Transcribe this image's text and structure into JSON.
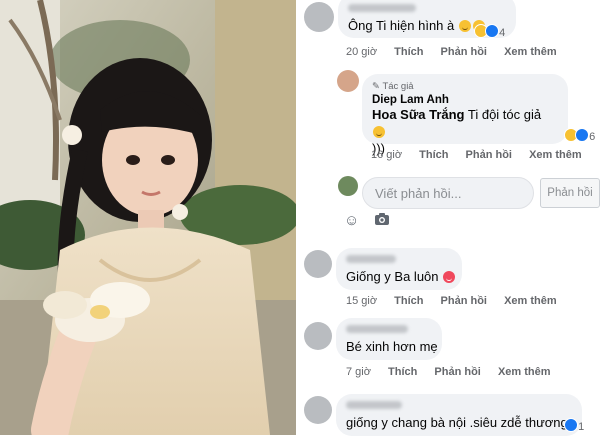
{
  "comments": [
    {
      "text": "Ông Ti hiện hình à",
      "reaction_count": "4",
      "meta": {
        "time": "20 giờ",
        "like": "Thích",
        "reply": "Phản hồi",
        "translate": "Xem thêm"
      }
    },
    {
      "author_badge": "Tác giả",
      "author_name": "Diep Lam Anh",
      "mention": "Hoa Sữa Trắng",
      "text": " Ti đội tóc giả",
      "text_line2": ")))",
      "reaction_count": "6",
      "meta": {
        "time": "16 giờ",
        "like": "Thích",
        "reply": "Phản hồi",
        "translate": "Xem thêm"
      }
    },
    {
      "text": "Giống y Ba luôn",
      "meta": {
        "time": "15 giờ",
        "like": "Thích",
        "reply": "Phản hồi",
        "translate": "Xem thêm"
      }
    },
    {
      "text": "Bé xinh hơn mẹ",
      "meta": {
        "time": "7 giờ",
        "like": "Thích",
        "reply": "Phản hồi",
        "translate": "Xem thêm"
      }
    },
    {
      "text": "giống y chang bà nội .siêu zdễ thương",
      "reaction_count": "1"
    }
  ],
  "reply_box": {
    "placeholder": "Viết phản hồi...",
    "button": "Phản hồi"
  },
  "icons": [
    "smiley-icon",
    "camera-icon",
    "haha-reaction-icon",
    "like-reaction-icon",
    "pencil-icon"
  ]
}
